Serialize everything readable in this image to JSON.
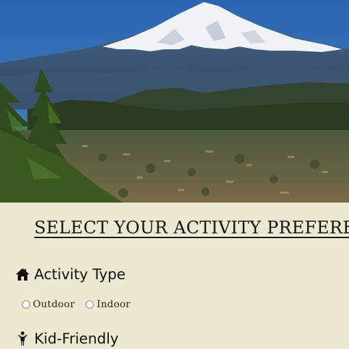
{
  "hero": {
    "image": "mountain-landscape",
    "colors": {
      "sky": "#2f6fb4",
      "snow": "#f2f3f5",
      "mountain": "#3d5873",
      "forest": "#2a3b1d",
      "town": "#8a7a55"
    }
  },
  "preferences": {
    "title": "SELECT YOUR ACTIVITY PREFEREN",
    "background": "#ede8d0",
    "activity_type": {
      "icon": "home-icon",
      "label": "Activity Type",
      "options": [
        {
          "label": "Outdoor",
          "selected": false
        },
        {
          "label": "Indoor",
          "selected": false
        }
      ]
    },
    "kid_friendly": {
      "icon": "child-icon",
      "label": "Kid-Friendly"
    }
  }
}
